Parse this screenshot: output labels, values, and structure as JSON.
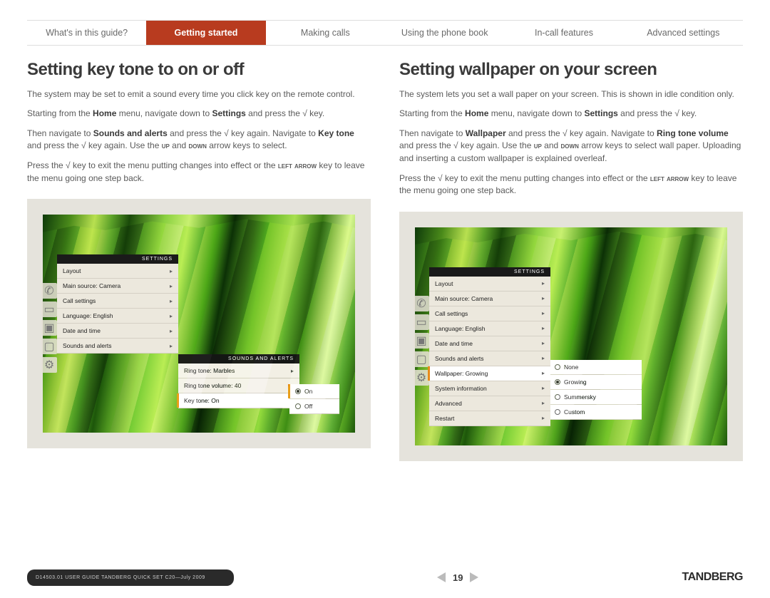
{
  "nav": {
    "items": [
      "What's in this guide?",
      "Getting started",
      "Making calls",
      "Using the phone book",
      "In-call features",
      "Advanced settings"
    ],
    "active_index": 1
  },
  "left": {
    "title": "Setting key tone to on or off",
    "p1": "The system may be set to emit a sound every time you click key on the remote control.",
    "p2_pre": "Starting from the ",
    "p2_home": "Home",
    "p2_mid": " menu, navigate down to ",
    "p2_settings": "Settings",
    "p2_post": " and press the √ key.",
    "p3_pre": "Then navigate to ",
    "p3_b1": "Sounds and alerts",
    "p3_mid1": " and press the √ key again. Navigate to ",
    "p3_b2": "Key tone",
    "p3_mid2": " and press the √ key again. Use the ",
    "p3_up": "up",
    "p3_and": " and ",
    "p3_down": "down",
    "p3_post": " arrow keys to select.",
    "p4_pre": "Press the √ key to exit the menu putting changes into effect or the ",
    "p4_la": "left arrow",
    "p4_post": " key to leave the menu going one step back.",
    "menu": {
      "header": "SETTINGS",
      "items": [
        "Layout",
        "Main source: Camera",
        "Call settings",
        "Language: English",
        "Date and time",
        "Sounds and alerts"
      ],
      "sub_header": "SOUNDS AND ALERTS",
      "sub_items": [
        "Ring tone: Marbles",
        "Ring tone volume: 40",
        "Key tone: On"
      ],
      "options": [
        "On",
        "Off"
      ],
      "selected_option": 0
    }
  },
  "right": {
    "title": "Setting wallpaper on your screen",
    "p1": "The system lets you set a wall paper on your screen. This is shown in idle condition only.",
    "p2_pre": "Starting from the ",
    "p2_home": "Home",
    "p2_mid": " menu, navigate down to ",
    "p2_settings": "Settings",
    "p2_post": " and press the √ key.",
    "p3_pre": "Then navigate to ",
    "p3_b1": "Wallpaper",
    "p3_mid1": " and press the √ key again. Navigate to ",
    "p3_b2": "Ring tone volume",
    "p3_mid2": " and press the √ key again. Use the ",
    "p3_up": "up",
    "p3_and": " and ",
    "p3_down": "down",
    "p3_post": " arrow keys to select wall paper. Uploading and inserting a custom wallpaper is explained overleaf.",
    "p4_pre": "Press the √ key to exit the menu putting changes into effect or the ",
    "p4_la": "left arrow",
    "p4_post": " key to leave the menu going one step back.",
    "menu": {
      "header": "SETTINGS",
      "items": [
        "Layout",
        "Main source: Camera",
        "Call settings",
        "Language: English",
        "Date and time",
        "Sounds and alerts",
        "Wallpaper: Growing",
        "System information",
        "Advanced",
        "Restart"
      ],
      "highlight_index": 6,
      "options": [
        "None",
        "Growing",
        "Summersky",
        "Custom"
      ],
      "selected_option": 1,
      "focus_option": 0
    }
  },
  "footer": {
    "docid": "D14503.01 USER GUIDE TANDBERG QUICK SET C20—July 2009",
    "page": "19",
    "brand": "TANDBERG"
  }
}
